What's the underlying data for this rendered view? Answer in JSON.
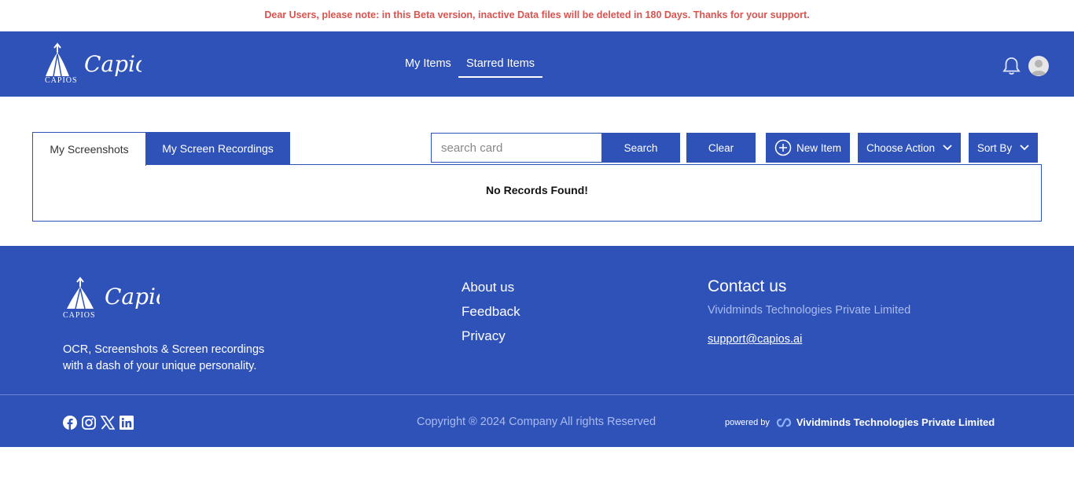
{
  "notice": "Dear Users, please note: in this Beta version, inactive Data files will be deleted in 180 Days. Thanks for your support.",
  "header": {
    "logo_script": "Capios",
    "logo_caps": "CAPIOS",
    "nav": [
      {
        "label": "My Items"
      },
      {
        "label": "Starred Items"
      }
    ]
  },
  "tabs": [
    {
      "label": "My Screenshots"
    },
    {
      "label": "My Screen Recordings"
    }
  ],
  "toolbar": {
    "search_placeholder": "search card",
    "search_label": "Search",
    "clear_label": "Clear",
    "new_item_label": "New Item",
    "choose_action_label": "Choose Action",
    "sort_by_label": "Sort By"
  },
  "results": {
    "empty_text": "No Records Found!"
  },
  "footer": {
    "logo_script": "Capios",
    "logo_caps": "CAPIOS",
    "tagline_line1": "OCR, Screenshots & Screen recordings",
    "tagline_line2": "with a dash of your unique personality.",
    "links": [
      {
        "label": "About us"
      },
      {
        "label": "Feedback"
      },
      {
        "label": "Privacy"
      }
    ],
    "contact_title": "Contact us",
    "company": "Vividminds Technologies Private Limited",
    "email": "support@capios.ai",
    "copyright": "Copyright ® 2024 Company All rights Reserved",
    "powered_by": "powered by",
    "powered_company": "Vividminds Technologies Private Limited",
    "social_icons": [
      "facebook-icon",
      "instagram-icon",
      "x-icon",
      "linkedin-icon"
    ]
  },
  "colors": {
    "primary": "#2f52b8",
    "notice": "#d9534f",
    "muted_text": "#a9bbf0"
  }
}
